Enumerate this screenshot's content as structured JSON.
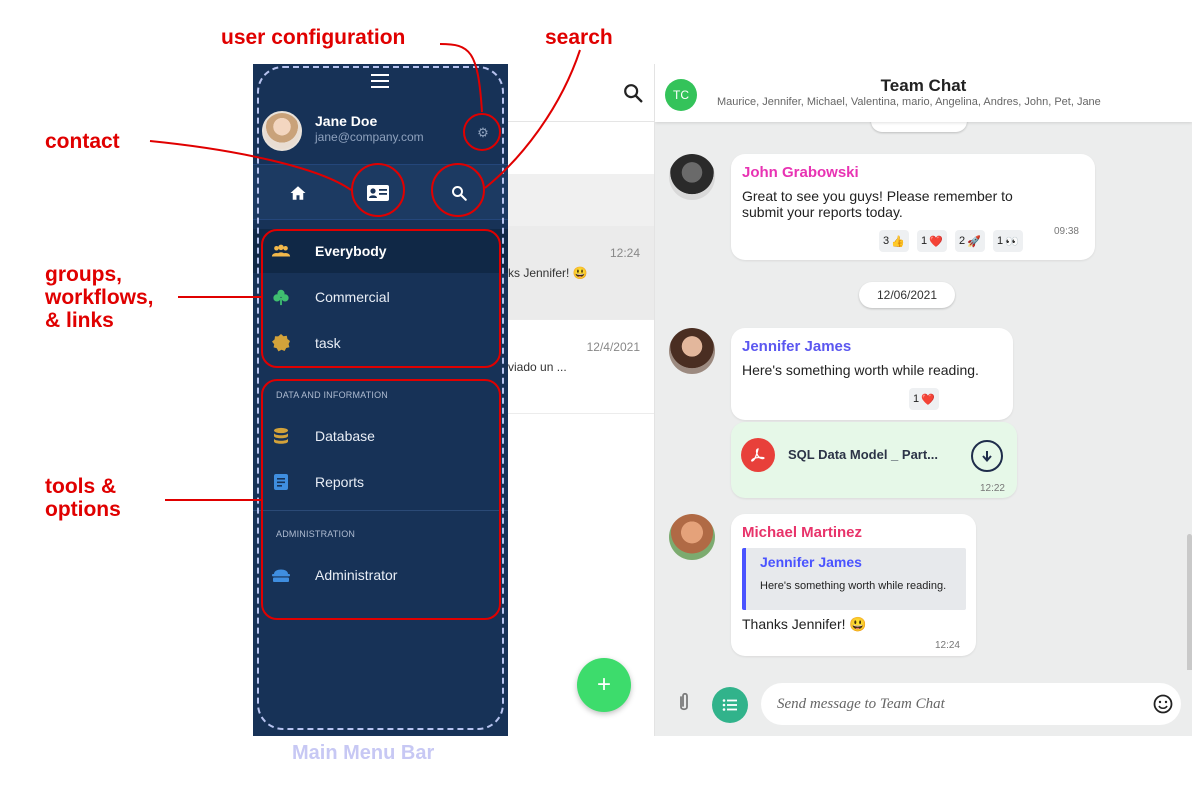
{
  "annotations": {
    "user_configuration": "user configuration",
    "search": "search",
    "contact": "contact",
    "groups_line1": "groups,",
    "groups_line2": "workflows,",
    "groups_line3": "& links",
    "tools_line1": "tools &",
    "tools_line2": "options",
    "footer": "Main Menu Bar"
  },
  "sidebar": {
    "user_name": "Jane Doe",
    "user_email": "jane@company.com",
    "groups": [
      {
        "label": "Everybody",
        "icon": "group-icon",
        "color": "#f2b84b"
      },
      {
        "label": "Commercial",
        "icon": "clover-icon",
        "color": "#3fbf70"
      },
      {
        "label": "task",
        "icon": "badge-icon",
        "color": "#d3a23a"
      }
    ],
    "section_data": "DATA AND INFORMATION",
    "tools": [
      {
        "label": "Database",
        "icon": "database-icon",
        "color": "#d3a23a"
      },
      {
        "label": "Reports",
        "icon": "document-icon",
        "color": "#3f8ee0"
      }
    ],
    "section_admin": "ADMINISTRATION",
    "admin": [
      {
        "label": "Administrator",
        "icon": "admin-icon",
        "color": "#3f8ee0"
      }
    ]
  },
  "chat_list": {
    "rows": [
      {
        "time": "12:24",
        "snippet": "ks Jennifer! 😃"
      },
      {
        "time": "12/4/2021",
        "snippet": "viado un ..."
      }
    ]
  },
  "chat": {
    "avatar_initials": "TC",
    "title": "Team Chat",
    "members": "Maurice, Jennifer, Michael, Valentina, mario, Angelina, Andres, John, Pet, Jane",
    "date_pill": "12/06/2021",
    "messages": [
      {
        "sender": "John Grabowski",
        "sender_color": "#e833b3",
        "text_line1": "Great to see you guys! Please remember to",
        "text_line2": "submit your reports today.",
        "time": "09:38",
        "reactions": [
          {
            "count": "3",
            "emoji": "👍"
          },
          {
            "count": "1",
            "emoji": "❤️"
          },
          {
            "count": "2",
            "emoji": "🚀"
          },
          {
            "count": "1",
            "emoji": "👀"
          }
        ]
      },
      {
        "sender": "Jennifer James",
        "sender_color": "#5b57f0",
        "text": "Here's something worth while reading.",
        "reactions": [
          {
            "count": "1",
            "emoji": "❤️"
          }
        ],
        "file_name": "SQL Data Model _ Part...",
        "file_time": "12:22"
      },
      {
        "sender": "Michael Martinez",
        "sender_color": "#e8336a",
        "quote_sender": "Jennifer James",
        "quote_text": "Here's something worth while reading.",
        "text": "Thanks Jennifer! 😃",
        "time": "12:24"
      }
    ],
    "composer_placeholder": "Send message to Team Chat"
  }
}
